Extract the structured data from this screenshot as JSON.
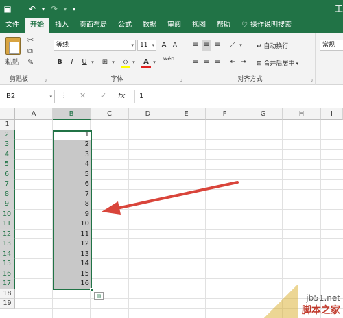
{
  "titlebar": {
    "save_icon": "save-icon",
    "undo_icon": "undo-icon",
    "redo_icon": "redo-icon",
    "customize_icon": "chevron-down-icon",
    "title_clip": "工"
  },
  "tabs": [
    {
      "label": "文件"
    },
    {
      "label": "开始"
    },
    {
      "label": "插入"
    },
    {
      "label": "页面布局"
    },
    {
      "label": "公式"
    },
    {
      "label": "数据"
    },
    {
      "label": "审阅"
    },
    {
      "label": "视图"
    },
    {
      "label": "帮助"
    },
    {
      "label": "操作说明搜索"
    }
  ],
  "ribbon": {
    "clipboard": {
      "paste_label": "粘贴",
      "group_label": "剪贴板"
    },
    "font": {
      "font_name": "等线",
      "font_size": "11",
      "grow": "A",
      "shrink": "A",
      "bold": "B",
      "italic": "I",
      "underline": "U",
      "wen": "wén",
      "group_label": "字体"
    },
    "align": {
      "wrap_label": "自动换行",
      "merge_label": "合并后居中",
      "group_label": "对齐方式"
    },
    "number": {
      "format": "常规"
    }
  },
  "formula_bar": {
    "name_box": "B2",
    "cancel": "✕",
    "enter": "✓",
    "fx": "fx",
    "value": "1"
  },
  "sheet": {
    "columns": [
      "A",
      "B",
      "C",
      "D",
      "E",
      "F",
      "G",
      "H",
      "I"
    ],
    "rows": [
      "1",
      "2",
      "3",
      "4",
      "5",
      "6",
      "7",
      "8",
      "9",
      "10",
      "11",
      "12",
      "13",
      "14",
      "15",
      "16",
      "17",
      "18",
      "19"
    ],
    "b_values": [
      "1",
      "2",
      "3",
      "4",
      "5",
      "6",
      "7",
      "8",
      "9",
      "10",
      "11",
      "12",
      "13",
      "14",
      "15",
      "16"
    ],
    "selected_column": "B",
    "selected_range": "B2:B17"
  },
  "watermark": {
    "site": "jb51.net",
    "name": "脚本之家"
  },
  "colors": {
    "excel_green": "#217346",
    "selection": "#c8c8c8",
    "arrow": "#d9453b"
  }
}
